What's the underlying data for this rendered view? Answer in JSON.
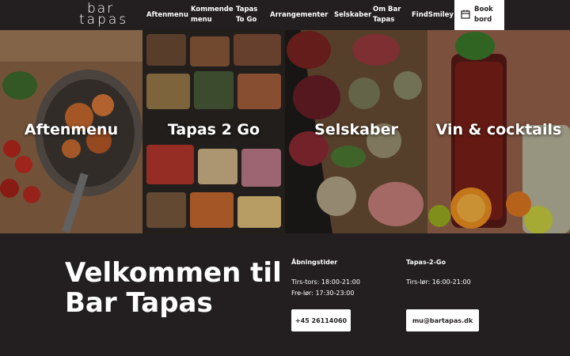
{
  "brand": {
    "line1": "bar",
    "line2": "tapas"
  },
  "nav": {
    "items": [
      {
        "label": "Aftenmenu"
      },
      {
        "label": "Kommende menu"
      },
      {
        "label": "Tapas To Go"
      },
      {
        "label": "Arrangementer"
      },
      {
        "label": "Selskaber"
      },
      {
        "label": "Om Bar Tapas"
      },
      {
        "label": "FindSmiley"
      }
    ],
    "book_label": "Book bord",
    "book_icon": "calendar-icon"
  },
  "tiles": [
    {
      "title": "Aftenmenu"
    },
    {
      "title": "Tapas 2 Go"
    },
    {
      "title": "Selskaber"
    },
    {
      "title": "Vin & cocktails"
    }
  ],
  "welcome": {
    "heading": "Velkommen til Bar Tapas"
  },
  "hours": {
    "heading": "Åbningstider",
    "line1": "Tirs-tors: 18:00-21:00",
    "line2": "Fre-lør: 17:30-23:00",
    "phone": "+45 26114060"
  },
  "togo": {
    "heading": "Tapas-2-Go",
    "line1": "Tirs-lør: 16:00-21:00",
    "email": "mu@bartapas.dk"
  },
  "colors": {
    "background": "#231f20",
    "text": "#ffffff",
    "button": "#ffffff"
  }
}
